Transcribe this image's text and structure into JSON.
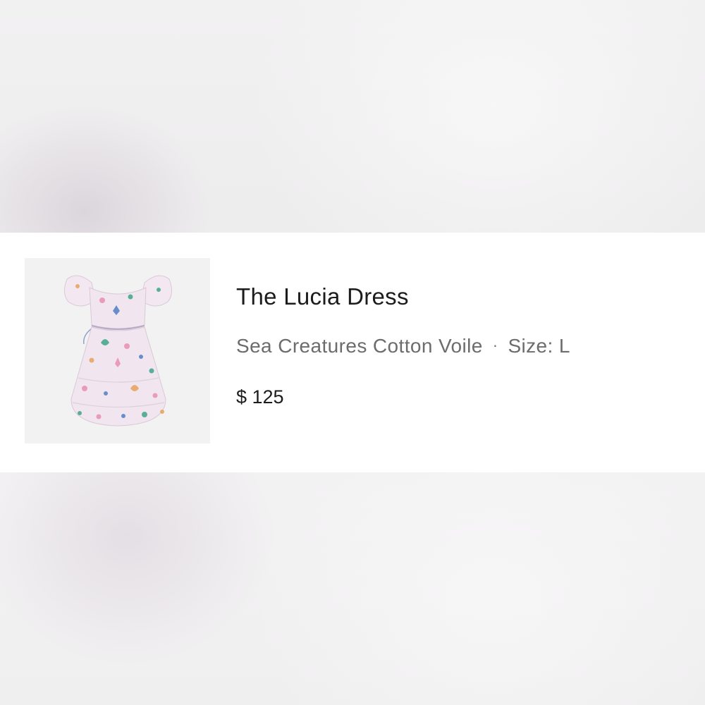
{
  "product": {
    "image_alt": "dress-photo",
    "title": "The Lucia Dress",
    "fabric": "Sea Creatures Cotton Voile",
    "separator": "·",
    "size": "Size: L",
    "price": "$ 125"
  },
  "colors": {
    "dress_base": "#f1e6f0",
    "print_pink": "#e88fb0",
    "print_teal": "#3fa58a",
    "print_blue": "#4f7fc4",
    "print_orange": "#e8a25a"
  }
}
